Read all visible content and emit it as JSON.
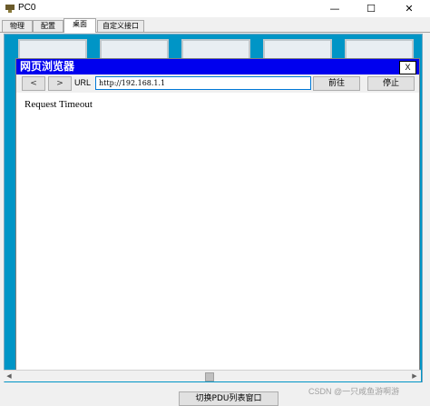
{
  "window": {
    "title": "PC0",
    "minimize": "—",
    "maximize": "☐",
    "close": "✕"
  },
  "tabs": [
    {
      "label": "物理",
      "active": false
    },
    {
      "label": "配置",
      "active": false
    },
    {
      "label": "桌面",
      "active": true
    },
    {
      "label": "自定义接口",
      "active": false
    }
  ],
  "browser": {
    "title": "网页浏览器",
    "close_label": "X",
    "back_label": "<",
    "forward_label": ">",
    "url_label": "URL",
    "url_value": "http://192.168.1.1",
    "go_label": "前往",
    "stop_label": "停止",
    "content_text": "Request Timeout"
  },
  "scrollbar": {
    "left_arrow": "◀",
    "right_arrow": "▶"
  },
  "bottom": {
    "pdu_button_label": "切换PDU列表窗口"
  },
  "watermark": "CSDN @一只咸鱼游啊游",
  "colors": {
    "browser_title_bg": "#0000ee",
    "desktop_bg": "#0095c6"
  }
}
